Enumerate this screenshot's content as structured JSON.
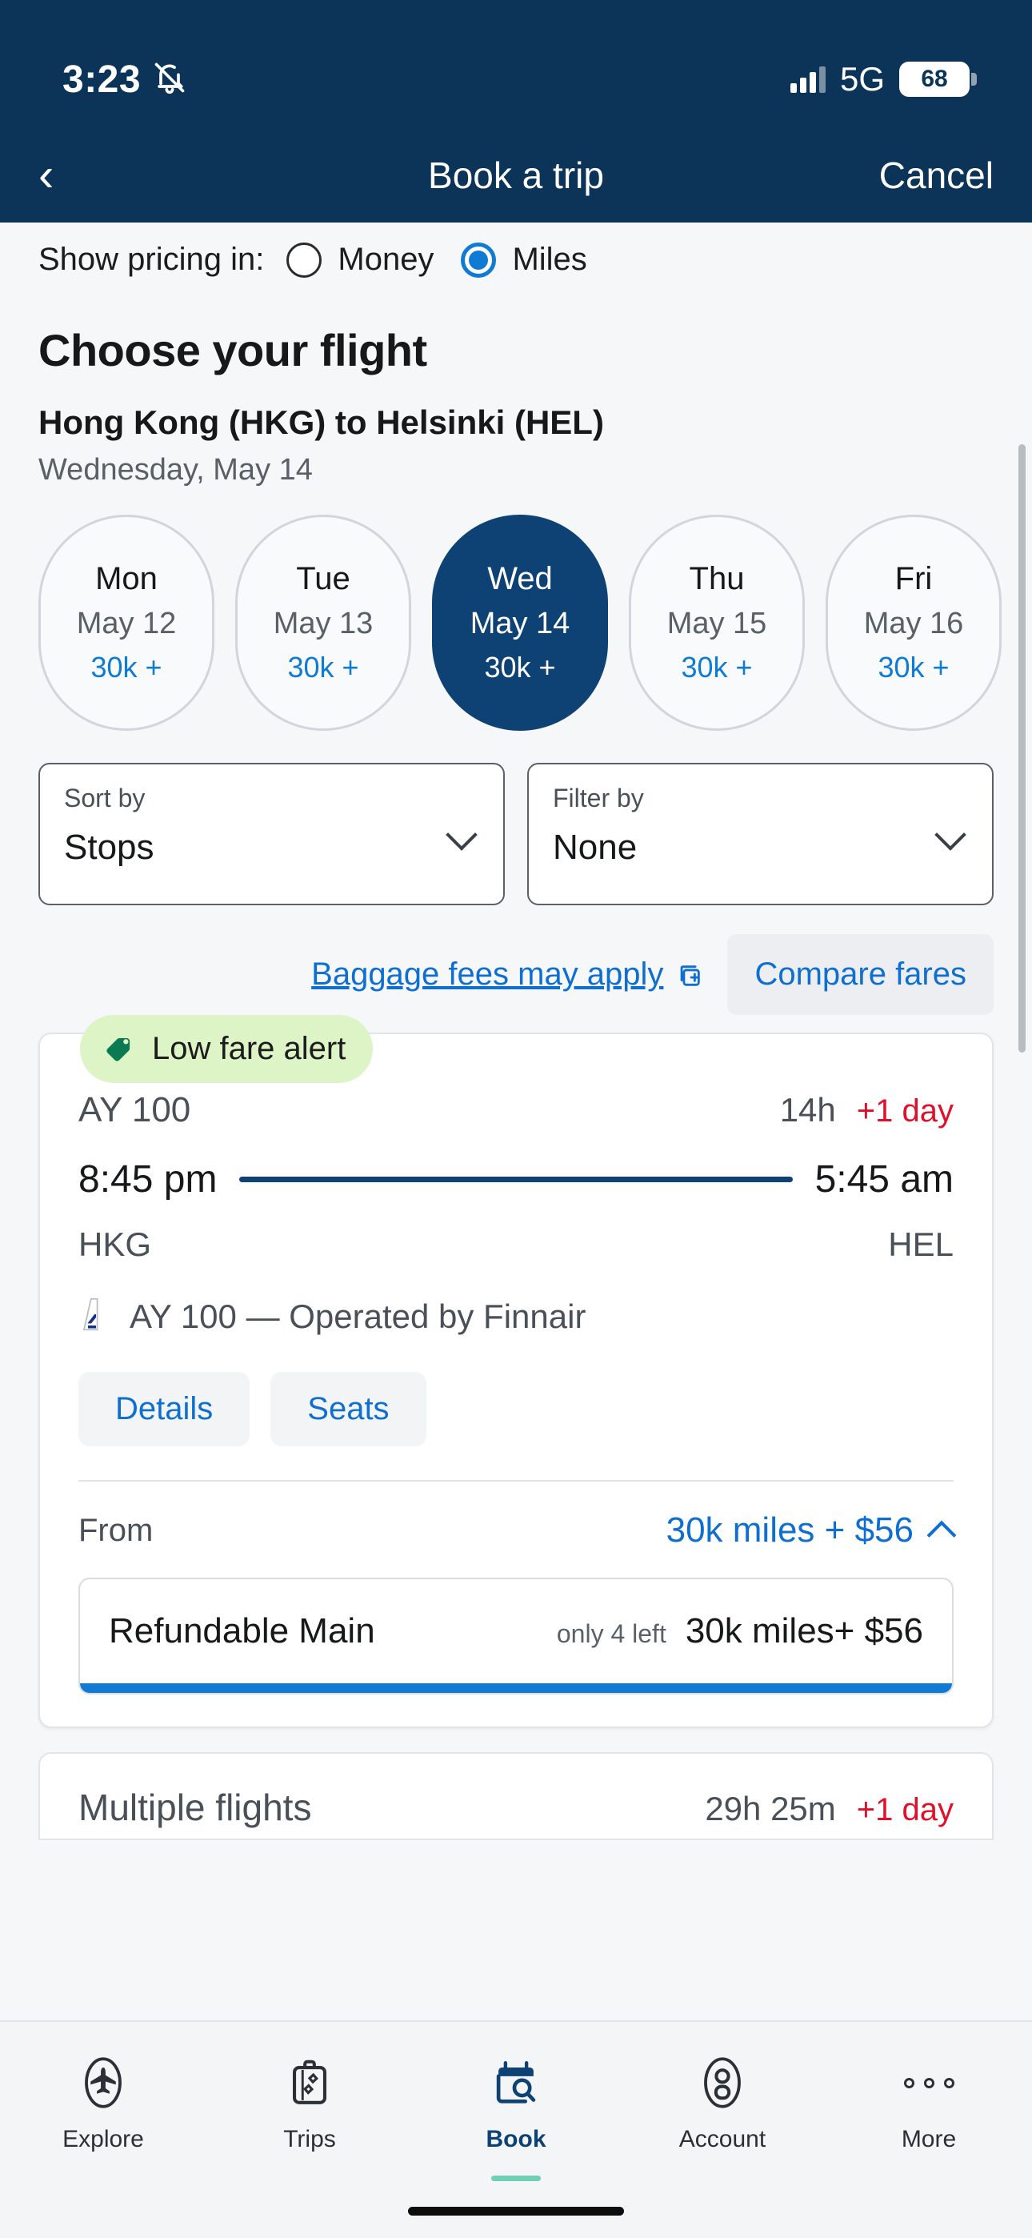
{
  "status_bar": {
    "time": "3:23",
    "bell_icon": "bell-slash-icon",
    "network": "5G",
    "battery": "68"
  },
  "nav": {
    "back_icon": "chevron-left-icon",
    "title": "Book a trip",
    "cancel": "Cancel"
  },
  "pricing": {
    "label": "Show pricing in:",
    "options": [
      {
        "label": "Money",
        "selected": false
      },
      {
        "label": "Miles",
        "selected": true
      }
    ],
    "selected_color": "#0f7bd4"
  },
  "page": {
    "title": "Choose your flight",
    "route": "Hong Kong (HKG) to Helsinki (HEL)",
    "date": "Wednesday, May 14"
  },
  "dates": [
    {
      "day": "Mon",
      "date": "May 12",
      "price": "30k +",
      "selected": false
    },
    {
      "day": "Tue",
      "date": "May 13",
      "price": "30k +",
      "selected": false
    },
    {
      "day": "Wed",
      "date": "May 14",
      "price": "30k +",
      "selected": true
    },
    {
      "day": "Thu",
      "date": "May 15",
      "price": "30k +",
      "selected": false
    },
    {
      "day": "Fri",
      "date": "May 16",
      "price": "30k +",
      "selected": false
    }
  ],
  "selects": {
    "sort": {
      "label": "Sort by",
      "value": "Stops"
    },
    "filter": {
      "label": "Filter by",
      "value": "None"
    }
  },
  "links": {
    "baggage": "Baggage fees may apply",
    "baggage_icon": "external-window-icon",
    "compare": "Compare fares"
  },
  "flight_card": {
    "badge": {
      "text": "Low fare alert",
      "icon": "price-tag-icon",
      "bg": "#ddf5c6"
    },
    "flight_number": "AY 100",
    "duration": "14h",
    "day_offset": "+1 day",
    "day_offset_color": "#e0102b",
    "depart_time": "8:45 pm",
    "arrive_time": "5:45 am",
    "origin": "HKG",
    "destination": "HEL",
    "operated_by": "AY 100 — Operated by Finnair",
    "airline_icon": "finnair-tail-icon",
    "buttons": [
      {
        "label": "Details"
      },
      {
        "label": "Seats"
      }
    ],
    "from_label": "From",
    "from_price": "30k miles + $56",
    "expand_icon": "chevron-up-icon",
    "fares": [
      {
        "name": "Refundable Main",
        "seats_left": "only 4 left",
        "price": "30k miles+ $56",
        "bar_color": "#0f7bd4"
      }
    ]
  },
  "flight_card_2": {
    "title": "Multiple flights",
    "duration": "29h 25m",
    "day_offset": "+1 day"
  },
  "tabs": [
    {
      "label": "Explore",
      "icon": "airplane-icon",
      "active": false
    },
    {
      "label": "Trips",
      "icon": "suitcase-icon",
      "active": false
    },
    {
      "label": "Book",
      "icon": "calendar-search-icon",
      "active": true
    },
    {
      "label": "Account",
      "icon": "person-icon",
      "active": false
    },
    {
      "label": "More",
      "icon": "ellipsis-icon",
      "active": false
    }
  ]
}
